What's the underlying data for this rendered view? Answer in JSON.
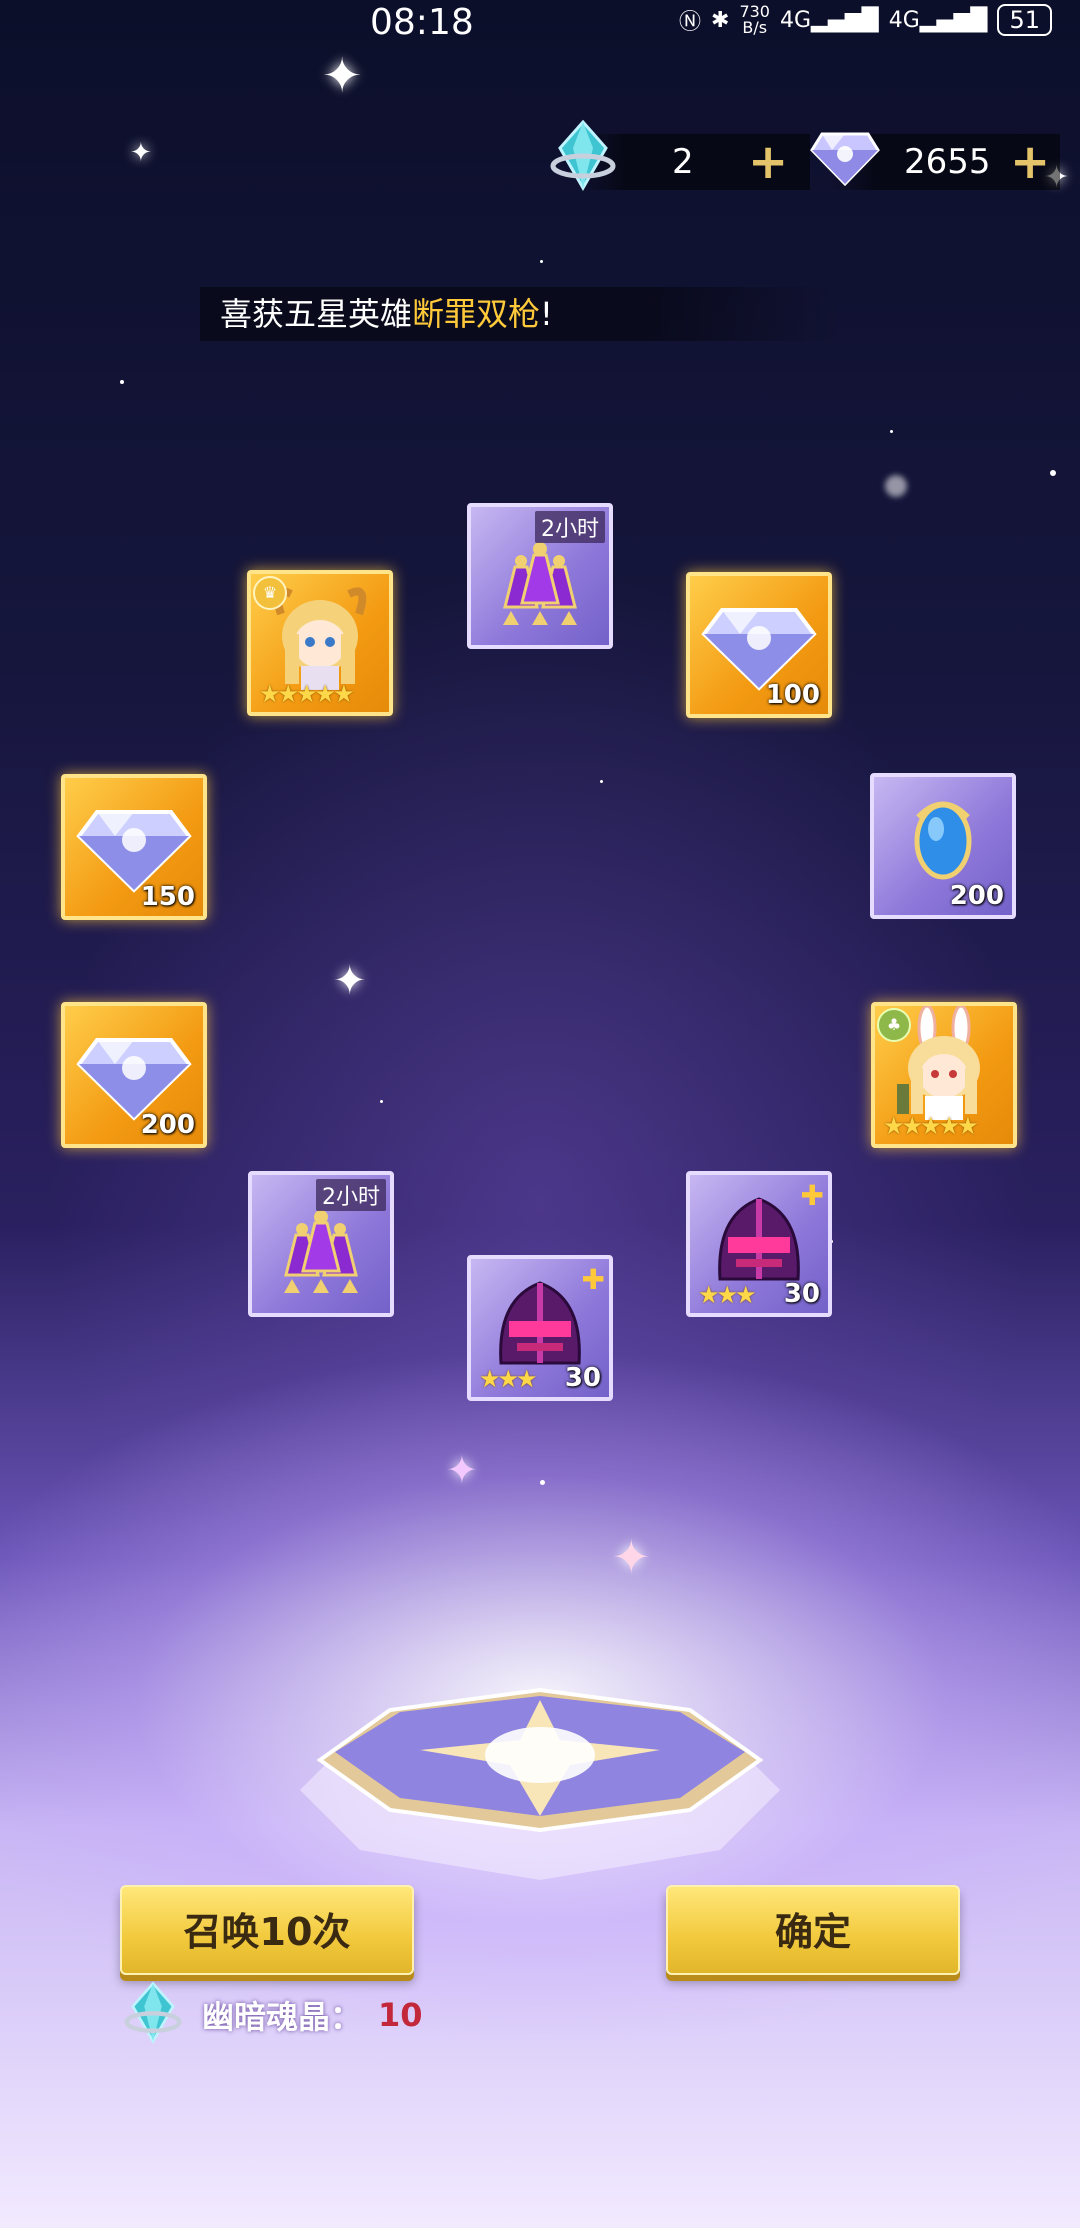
{
  "status_bar": {
    "time": "08:18",
    "network_speed_top": "730",
    "network_speed_bottom": "B/s",
    "signal_1": "4G",
    "signal_2": "4G",
    "battery": "51"
  },
  "currencies": {
    "dark_crystal": {
      "icon": "soul-crystal-icon",
      "value": "2",
      "add_label": "+"
    },
    "diamond": {
      "icon": "diamond-icon",
      "value": "2655",
      "add_label": "+"
    }
  },
  "announcement": {
    "prefix": "喜获五星英雄",
    "hero_name": "断罪双枪",
    "suffix": "!"
  },
  "rewards": [
    {
      "id": "hero-1",
      "type": "hero",
      "rarity": "gold",
      "stars": "★★★★★",
      "icon": "hero-horned-girl-icon"
    },
    {
      "id": "potion-1",
      "type": "exp-potion",
      "rarity": "purple",
      "tag": "2小时",
      "icon": "potion-bottles-icon"
    },
    {
      "id": "diamond-100",
      "type": "diamond",
      "rarity": "gold",
      "qty": "100",
      "icon": "diamond-icon"
    },
    {
      "id": "diamond-150",
      "type": "diamond",
      "rarity": "gold",
      "qty": "150",
      "icon": "diamond-icon"
    },
    {
      "id": "egg-200",
      "type": "egg",
      "rarity": "purple",
      "qty": "200",
      "icon": "blue-egg-icon"
    },
    {
      "id": "diamond-200",
      "type": "diamond",
      "rarity": "gold",
      "qty": "200",
      "icon": "diamond-icon"
    },
    {
      "id": "hero-2",
      "type": "hero",
      "rarity": "gold",
      "stars": "★★★★★",
      "icon": "hero-bunny-girl-icon"
    },
    {
      "id": "potion-2",
      "type": "exp-potion",
      "rarity": "purple",
      "tag": "2小时",
      "icon": "potion-bottles-icon"
    },
    {
      "id": "helmet-1",
      "type": "hero-shard",
      "rarity": "purple",
      "stars": "★★★",
      "qty": "30",
      "icon": "dark-helmet-icon"
    },
    {
      "id": "helmet-2",
      "type": "hero-shard",
      "rarity": "purple",
      "stars": "★★★",
      "qty": "30",
      "icon": "dark-helmet-icon"
    }
  ],
  "buttons": {
    "summon_label": "召唤10次",
    "confirm_label": "确定"
  },
  "cost": {
    "label": "幽暗魂晶：",
    "value": "10",
    "icon": "soul-crystal-icon"
  },
  "colors": {
    "highlight": "#ffc93a",
    "button": "#f2c93c",
    "cost_value": "#c2273a"
  }
}
